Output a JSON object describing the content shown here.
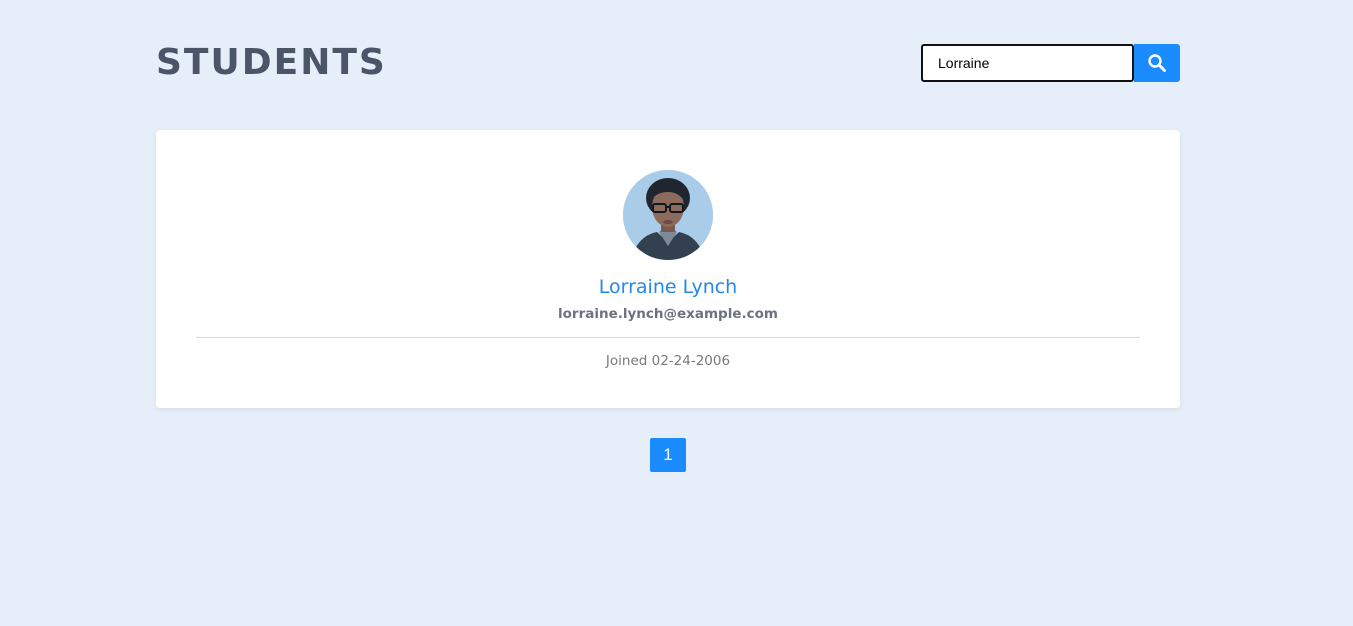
{
  "header": {
    "title": "STUDENTS"
  },
  "search": {
    "value": "Lorraine",
    "icon": "search-icon",
    "button_color": "#1a8cff"
  },
  "students": [
    {
      "name": "Lorraine Lynch",
      "email": "lorraine.lynch@example.com",
      "joined": "Joined 02-24-2006",
      "avatar_icon": "avatar-photo"
    }
  ],
  "pagination": {
    "pages": [
      "1"
    ],
    "active": "1"
  },
  "colors": {
    "background": "#e6eefa",
    "accent": "#1a8cff",
    "name": "#2388e8",
    "title": "#4a5568"
  }
}
